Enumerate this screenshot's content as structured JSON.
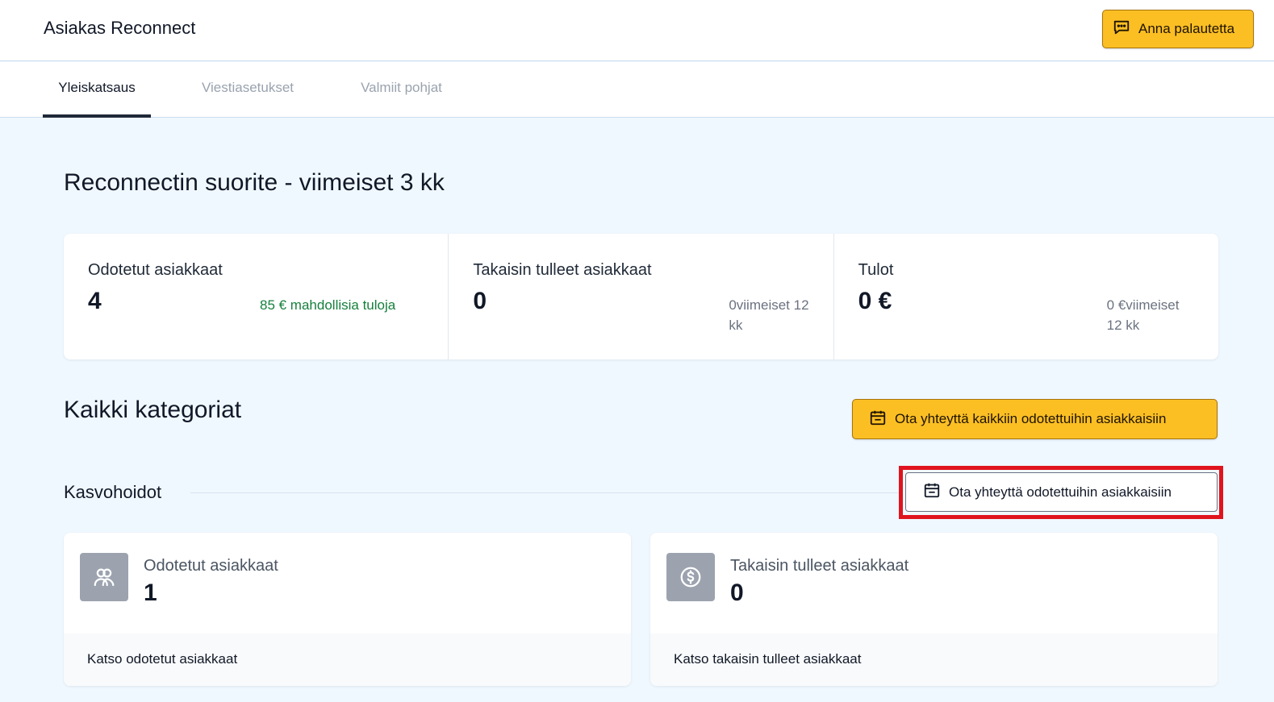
{
  "app": {
    "title": "Asiakas Reconnect"
  },
  "header": {
    "feedback_label": "Anna palautetta"
  },
  "tabs": [
    {
      "label": "Yleiskatsaus",
      "active": true
    },
    {
      "label": "Viestiasetukset",
      "active": false
    },
    {
      "label": "Valmiit pohjat",
      "active": false
    }
  ],
  "performance": {
    "title": "Reconnectin suorite - viimeiset 3 kk",
    "stats": [
      {
        "label": "Odotetut asiakkaat",
        "value": "4",
        "note": "85 € mahdollisia tuloja"
      },
      {
        "label": "Takaisin tulleet asiakkaat",
        "value": "0",
        "note": "0viimeiset 12 kk"
      },
      {
        "label": "Tulot",
        "value": "0 €",
        "note": "0 €viimeiset 12 kk"
      }
    ]
  },
  "categories": {
    "title": "Kaikki kategoriat",
    "contact_all_label": "Ota yhteyttä kaikkiin odotettuihin asiakkaisiin"
  },
  "section": {
    "title": "Kasvohoidot",
    "contact_label": "Ota yhteyttä odotettuihin asiakkaisiin",
    "cards": [
      {
        "label": "Odotetut asiakkaat",
        "value": "1",
        "link": "Katso odotetut asiakkaat",
        "icon": "users-icon"
      },
      {
        "label": "Takaisin tulleet asiakkaat",
        "value": "0",
        "link": "Katso takaisin tulleet asiakkaat",
        "icon": "dollar-circle-icon"
      }
    ]
  },
  "colors": {
    "accent": "#fbbf24",
    "highlight": "#e0141e",
    "positive": "#15803d"
  }
}
